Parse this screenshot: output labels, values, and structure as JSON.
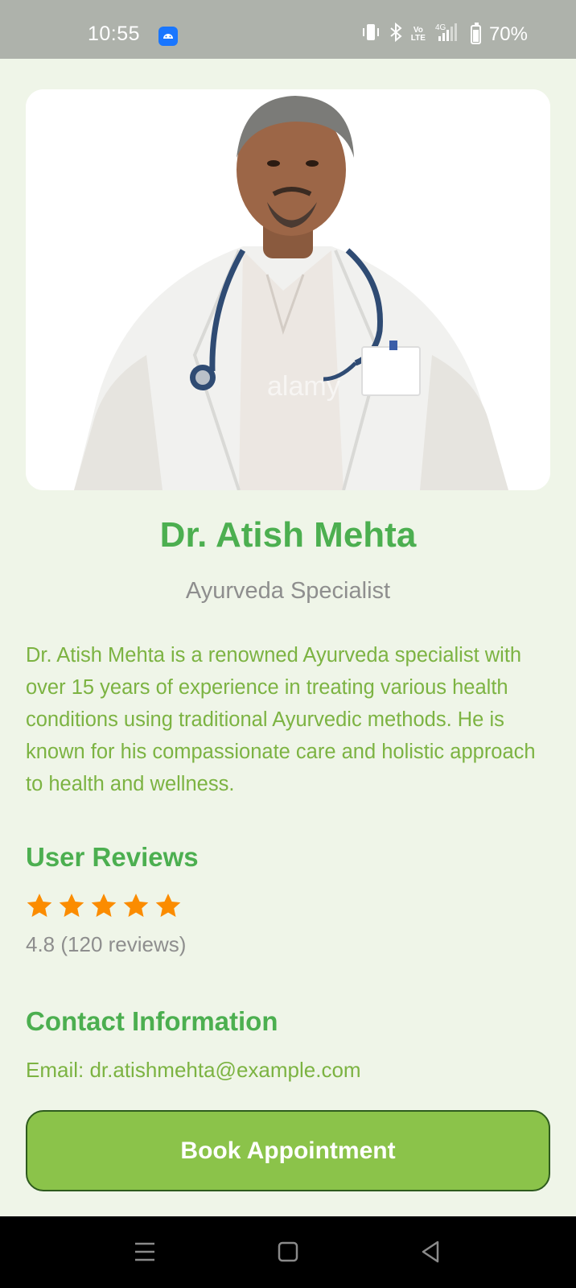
{
  "status_bar": {
    "time": "10:55",
    "battery": "70%",
    "network_top": "Vo",
    "network_bottom": "LTE",
    "signal_label": "4G"
  },
  "doctor": {
    "name": "Dr. Atish Mehta",
    "specialty": "Ayurveda Specialist",
    "bio": "Dr. Atish Mehta is a renowned Ayurveda specialist with over 15 years of experience in treating various health conditions using traditional Ayurvedic methods. He is known for his compassionate care and holistic approach to health and wellness.",
    "photo_watermark": "alamy"
  },
  "reviews": {
    "title": "User Reviews",
    "stars": 5,
    "rating_text": "4.8 (120 reviews)"
  },
  "contact": {
    "title": "Contact Information",
    "email": "Email: dr.atishmehta@example.com"
  },
  "actions": {
    "book_label": "Book Appointment"
  },
  "colors": {
    "background": "#eff5e8",
    "primary_green": "#4caf50",
    "text_green": "#7cb342",
    "button_green": "#8bc34a",
    "star_orange": "#fb8c00",
    "muted_gray": "#8e8e8e"
  }
}
